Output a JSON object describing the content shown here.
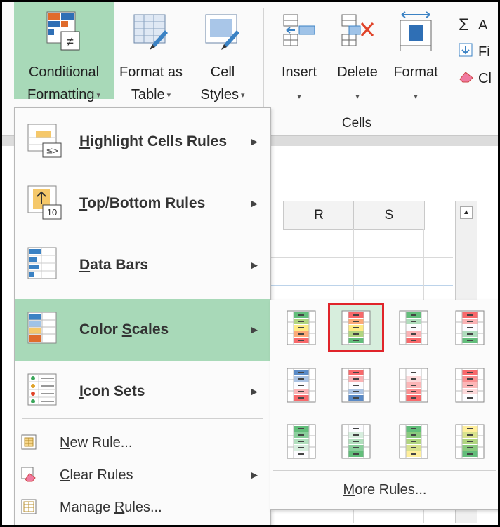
{
  "ribbon": {
    "conditional_formatting": {
      "line1": "Conditional",
      "line2": "Formatting"
    },
    "format_as_table": {
      "line1": "Format as",
      "line2": "Table"
    },
    "cell_styles": {
      "line1": "Cell",
      "line2": "Styles"
    },
    "insert": {
      "label": "Insert"
    },
    "delete": {
      "label": "Delete"
    },
    "format": {
      "label": "Format"
    },
    "cells_group": "Cells",
    "editing": [
      {
        "icon": "sigma-icon",
        "label": "A"
      },
      {
        "icon": "fill-down-icon",
        "label": "Fi"
      },
      {
        "icon": "eraser-icon",
        "label": "Cl"
      }
    ]
  },
  "sheet": {
    "columns": [
      "R",
      "S"
    ]
  },
  "menu": {
    "items": [
      {
        "icon": "highlight-cells-icon",
        "pre": "",
        "accel": "H",
        "post": "ighlight Cells Rules"
      },
      {
        "icon": "top-bottom-icon",
        "pre": "",
        "accel": "T",
        "post": "op/Bottom Rules"
      },
      {
        "icon": "data-bars-icon",
        "pre": "",
        "accel": "D",
        "post": "ata Bars"
      },
      {
        "icon": "color-scales-icon",
        "pre": "Color ",
        "accel": "S",
        "post": "cales"
      },
      {
        "icon": "icon-sets-icon",
        "pre": "",
        "accel": "I",
        "post": "con Sets"
      }
    ],
    "small_items": [
      {
        "icon": "new-rule-icon",
        "pre": "",
        "accel": "N",
        "post": "ew Rule..."
      },
      {
        "icon": "clear-rules-icon",
        "pre": "",
        "accel": "C",
        "post": "lear Rules"
      },
      {
        "icon": "manage-rules-icon",
        "pre": "Manage ",
        "accel": "R",
        "post": "ules..."
      }
    ]
  },
  "color_scales": {
    "swatches": [
      {
        "name": "green-yellow-red",
        "colors": [
          "#63be7b",
          "#ffeb84",
          "#f8696b"
        ],
        "selected": false
      },
      {
        "name": "red-yellow-green",
        "colors": [
          "#f8696b",
          "#ffeb84",
          "#63be7b"
        ],
        "selected": true
      },
      {
        "name": "green-white-red",
        "colors": [
          "#63be7b",
          "#fcfcff",
          "#f8696b"
        ],
        "selected": false
      },
      {
        "name": "red-white-green",
        "colors": [
          "#f8696b",
          "#fcfcff",
          "#63be7b"
        ],
        "selected": false
      },
      {
        "name": "blue-white-red",
        "colors": [
          "#5a8ac6",
          "#fcfcff",
          "#f8696b"
        ],
        "selected": false
      },
      {
        "name": "red-white-blue",
        "colors": [
          "#f8696b",
          "#fcfcff",
          "#5a8ac6"
        ],
        "selected": false
      },
      {
        "name": "white-red",
        "colors": [
          "#fcfcff",
          "#fcb6b7",
          "#f8696b"
        ],
        "selected": false
      },
      {
        "name": "red-white",
        "colors": [
          "#f8696b",
          "#fcb6b7",
          "#fcfcff"
        ],
        "selected": false
      },
      {
        "name": "green-white",
        "colors": [
          "#63be7b",
          "#b1dfbd",
          "#fcfcff"
        ],
        "selected": false
      },
      {
        "name": "white-green",
        "colors": [
          "#fcfcff",
          "#b1dfbd",
          "#63be7b"
        ],
        "selected": false
      },
      {
        "name": "green-yellow",
        "colors": [
          "#63be7b",
          "#b1d580",
          "#ffef9c"
        ],
        "selected": false
      },
      {
        "name": "yellow-green",
        "colors": [
          "#ffef9c",
          "#b1d580",
          "#63be7b"
        ],
        "selected": false
      }
    ],
    "more_rules": {
      "pre": "",
      "accel": "M",
      "post": "ore Rules..."
    }
  },
  "colors": {
    "selection_green": "#a8d9b8",
    "highlight_red": "#e0242a"
  }
}
